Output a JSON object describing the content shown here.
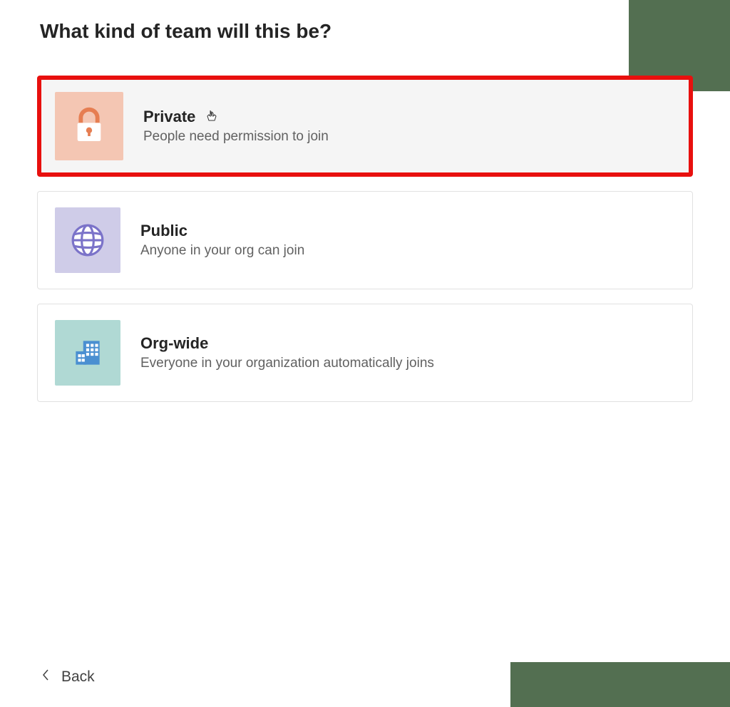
{
  "page_title": "What kind of team will this be?",
  "options": [
    {
      "title": "Private",
      "description": "People need permission to join",
      "icon": "lock-icon",
      "highlighted": true
    },
    {
      "title": "Public",
      "description": "Anyone in your org can join",
      "icon": "globe-icon",
      "highlighted": false
    },
    {
      "title": "Org-wide",
      "description": "Everyone in your organization automatically joins",
      "icon": "building-icon",
      "highlighted": false
    }
  ],
  "back_button_label": "Back"
}
